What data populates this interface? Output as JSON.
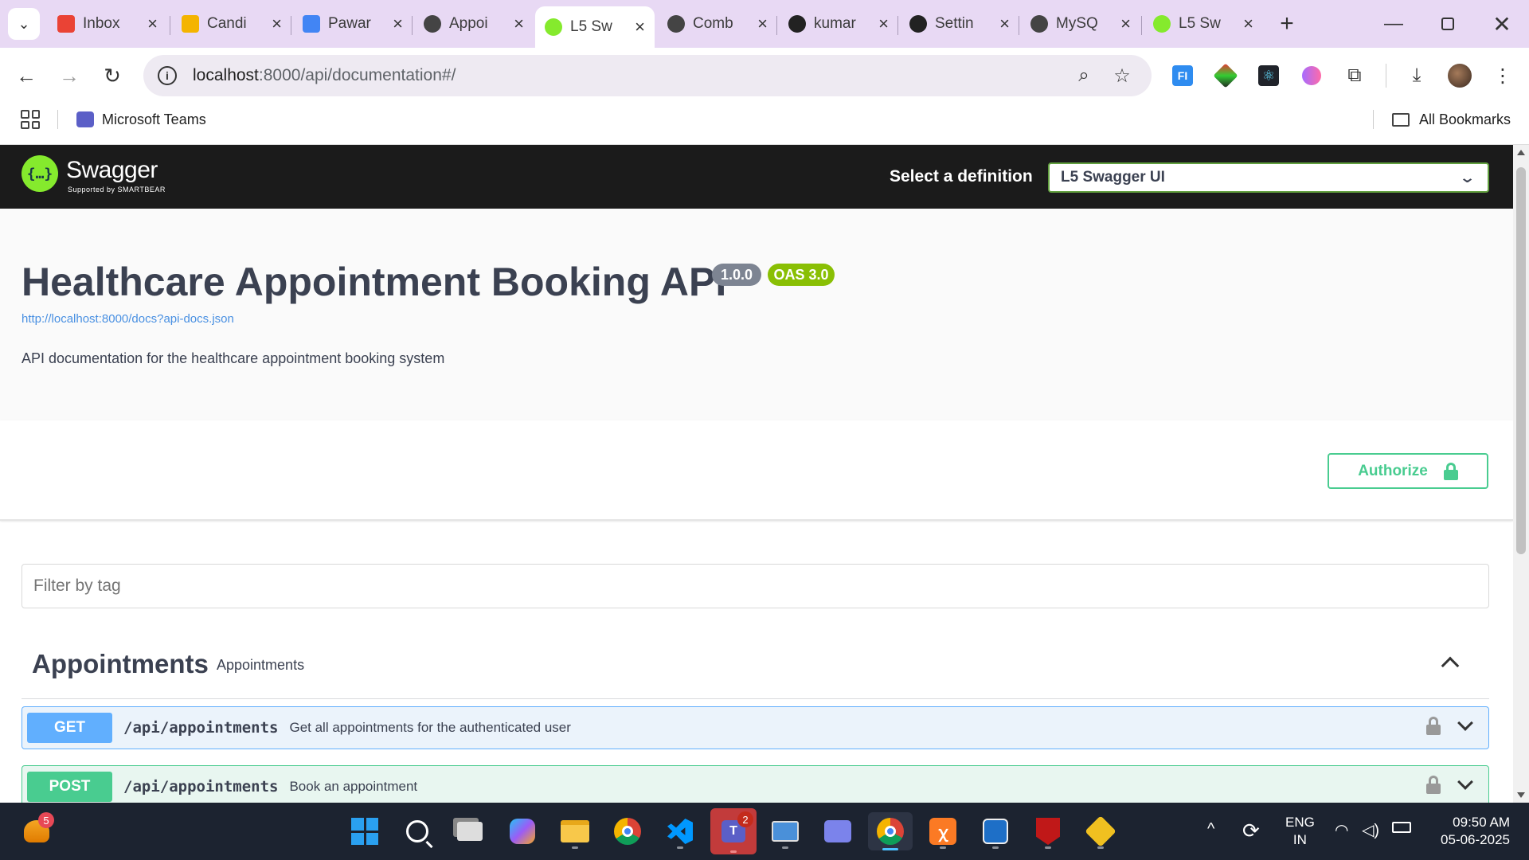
{
  "browser": {
    "tabs": [
      {
        "title": "Inbox",
        "icon": "gmail-icon",
        "color": "#ea4335"
      },
      {
        "title": "Candi",
        "icon": "sheets-icon",
        "color": "#f4b400"
      },
      {
        "title": "Pawar",
        "icon": "docs-icon",
        "color": "#4285f4"
      },
      {
        "title": "Appoi",
        "icon": "chatgpt-icon",
        "color": "#444444"
      },
      {
        "title": "L5 Sw",
        "icon": "swagger-icon",
        "color": "#85ea2d",
        "active": true
      },
      {
        "title": "Comb",
        "icon": "chatgpt-icon",
        "color": "#444444"
      },
      {
        "title": "kumar",
        "icon": "github-icon",
        "color": "#222222"
      },
      {
        "title": "Settin",
        "icon": "github-icon",
        "color": "#222222"
      },
      {
        "title": "MySQ",
        "icon": "chatgpt-icon",
        "color": "#444444"
      },
      {
        "title": "L5 Sw",
        "icon": "swagger-icon",
        "color": "#85ea2d"
      }
    ],
    "url_host": "localhost",
    "url_path": ":8000/api/documentation#/",
    "bookmarks": [
      {
        "label": "Microsoft Teams"
      }
    ],
    "all_bookmarks": "All Bookmarks"
  },
  "swagger": {
    "logo_text": "Swagger",
    "logo_sub": "Supported by SMARTBEAR",
    "select_label": "Select a definition",
    "selected_definition": "L5 Swagger UI",
    "title": "Healthcare Appointment Booking API",
    "version": "1.0.0",
    "oas": "OAS 3.0",
    "spec_link": "http://localhost:8000/docs?api-docs.json",
    "description": "API documentation for the healthcare appointment booking system",
    "authorize": "Authorize",
    "filter_placeholder": "Filter by tag",
    "tag": {
      "name": "Appointments",
      "description": "Appointments"
    },
    "operations": [
      {
        "method": "GET",
        "path": "/api/appointments",
        "summary": "Get all appointments for the authenticated user",
        "color": "#61affe",
        "bg": "#ebf3fb"
      },
      {
        "method": "POST",
        "path": "/api/appointments",
        "summary": "Book an appointment",
        "color": "#49cc90",
        "bg": "#e8f6f0"
      }
    ]
  },
  "taskbar": {
    "widget_badge": "5",
    "teams_badge": "2",
    "lang_line1": "ENG",
    "lang_line2": "IN",
    "time": "09:50 AM",
    "date": "05-06-2025"
  }
}
